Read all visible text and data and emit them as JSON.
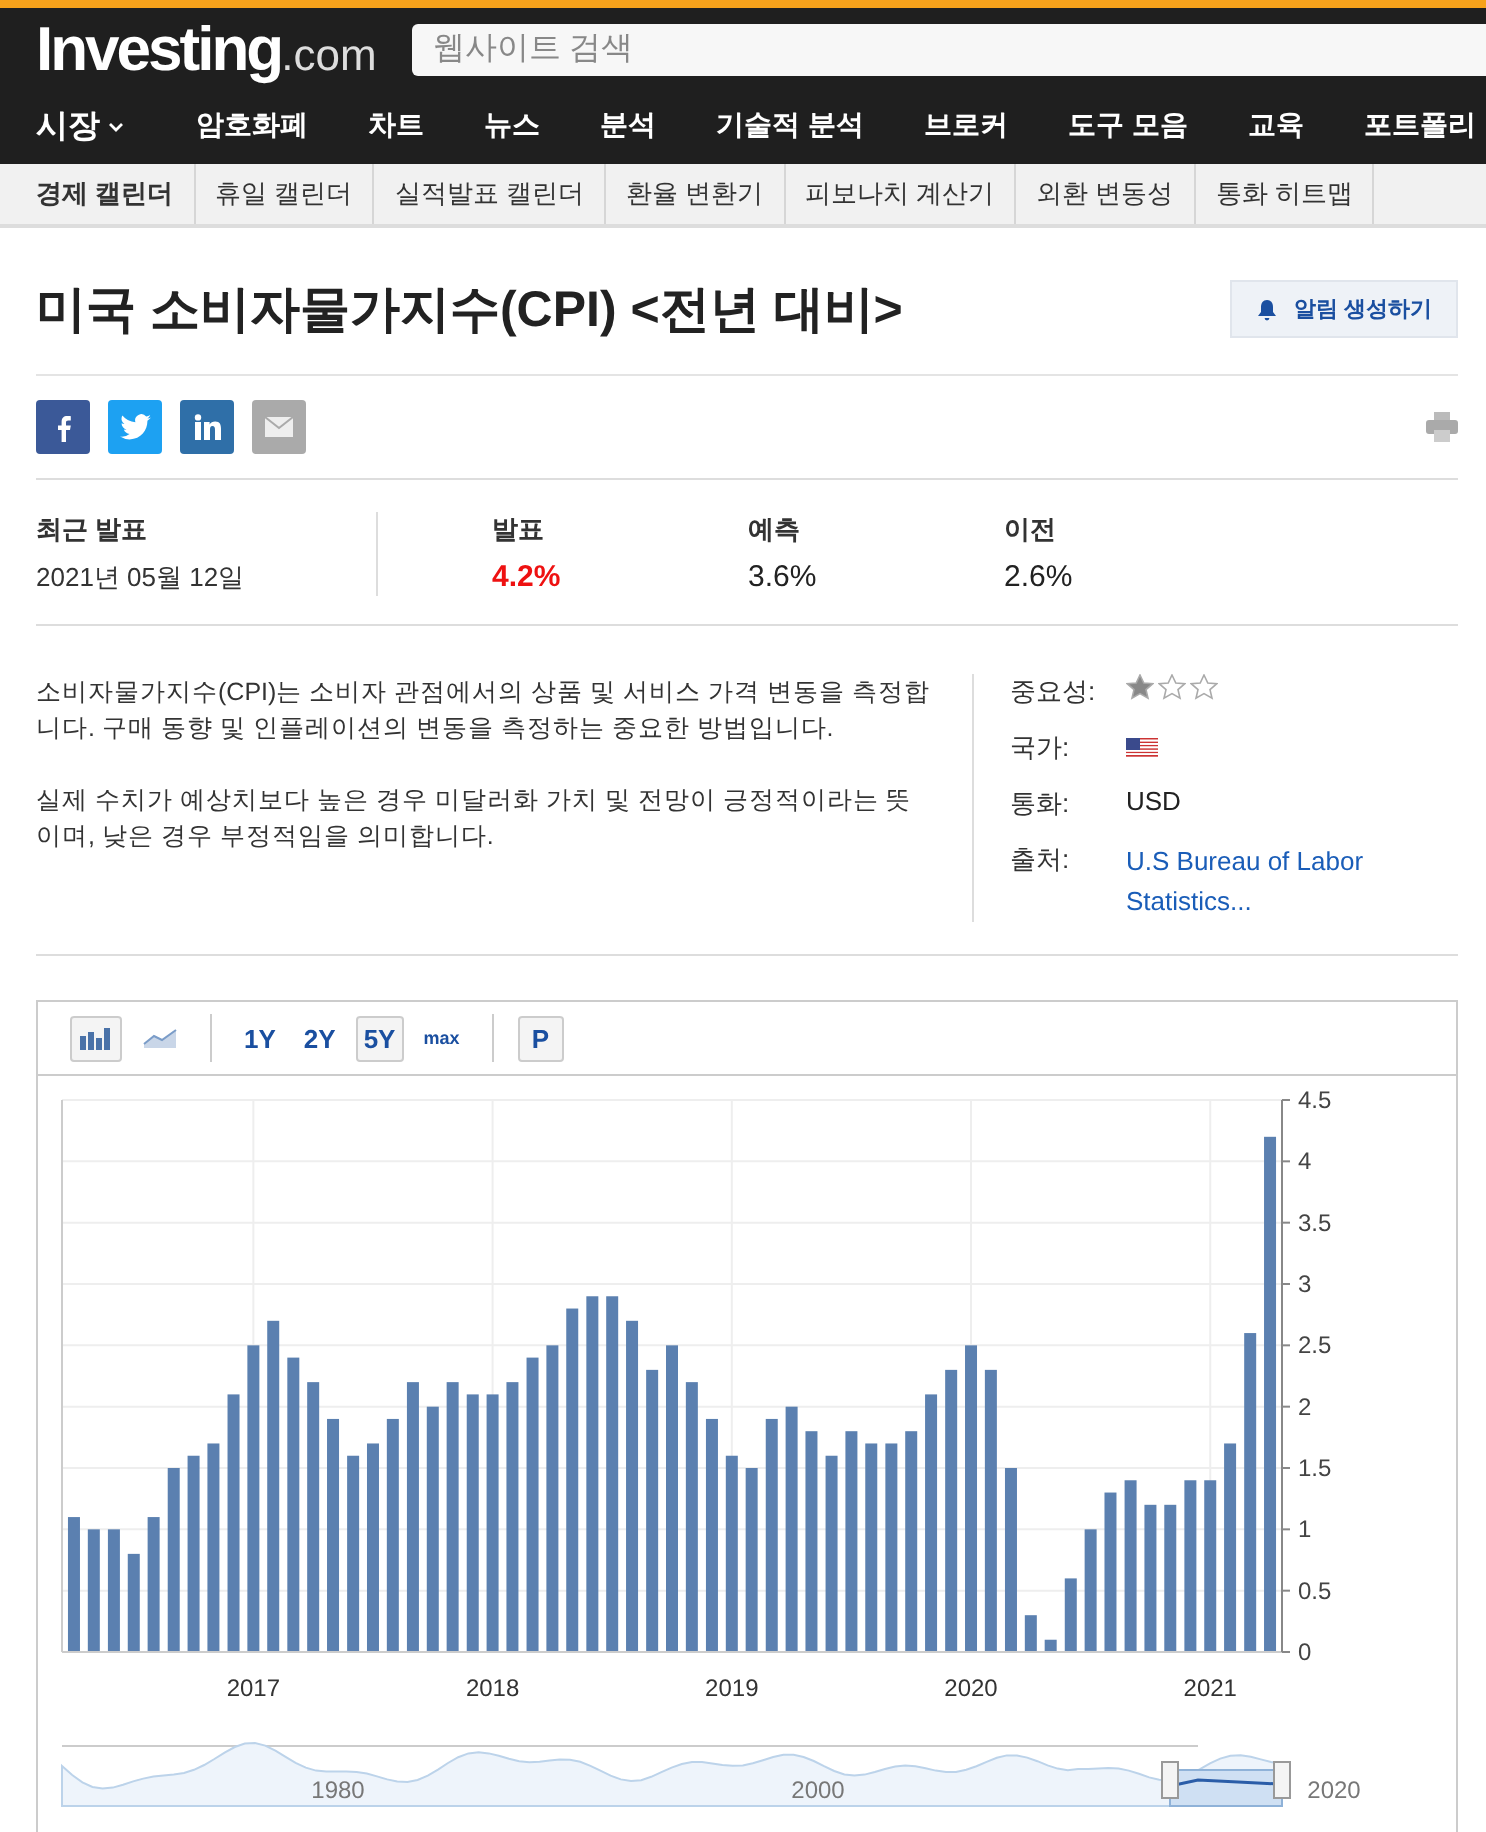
{
  "header": {
    "logo": {
      "main": "Investing",
      "suffix": ".com"
    },
    "search": {
      "placeholder": "웹사이트 검색"
    }
  },
  "nav": [
    {
      "label": "시장",
      "dropdown": true
    },
    {
      "label": "암호화폐",
      "dropdown": false
    },
    {
      "label": "차트",
      "dropdown": false
    },
    {
      "label": "뉴스",
      "dropdown": false
    },
    {
      "label": "분석",
      "dropdown": false
    },
    {
      "label": "기술적 분석",
      "dropdown": false
    },
    {
      "label": "브로커",
      "dropdown": false
    },
    {
      "label": "도구 모음",
      "dropdown": false
    },
    {
      "label": "교육",
      "dropdown": false
    },
    {
      "label": "포트폴리",
      "dropdown": false
    }
  ],
  "subnav": [
    {
      "label": "경제 캘린더",
      "selected": true
    },
    {
      "label": "휴일 캘린더",
      "selected": false
    },
    {
      "label": "실적발표 캘린더",
      "selected": false
    },
    {
      "label": "환율 변환기",
      "selected": false
    },
    {
      "label": "피보나치 계산기",
      "selected": false
    },
    {
      "label": "외환 변동성",
      "selected": false
    },
    {
      "label": "통화 히트맵",
      "selected": false
    }
  ],
  "title": "미국 소비자물가지수(CPI) <전년 대비>",
  "alert_button": "알림 생성하기",
  "release": {
    "label": "최근 발표",
    "date": "2021년 05월 12일",
    "values": [
      {
        "label": "발표",
        "value": "4.2%",
        "kind": "actual"
      },
      {
        "label": "예측",
        "value": "3.6%",
        "kind": "normal"
      },
      {
        "label": "이전",
        "value": "2.6%",
        "kind": "normal"
      }
    ]
  },
  "description": [
    "소비자물가지수(CPI)는 소비자 관점에서의 상품 및 서비스 가격 변동을 측정합니다. 구매 동향 및 인플레이션의 변동을 측정하는 중요한 방법입니다.",
    "실제 수치가 예상치보다 높은 경우 미달러화 가치 및 전망이 긍정적이라는 뜻이며, 낮은 경우 부정적임을 의미합니다."
  ],
  "info": [
    {
      "label": "중요성:",
      "kind": "stars",
      "stars": 1
    },
    {
      "label": "국가:",
      "kind": "flag"
    },
    {
      "label": "통화:",
      "kind": "text",
      "value": "USD"
    },
    {
      "label": "출처:",
      "kind": "link",
      "value": "U.S Bureau of Labor Statistics..."
    }
  ],
  "chart": {
    "types": [
      {
        "kind": "bar",
        "selected": true
      },
      {
        "kind": "line",
        "selected": false
      }
    ],
    "ranges": [
      {
        "label": "1Y",
        "selected": false
      },
      {
        "label": "2Y",
        "selected": false
      },
      {
        "label": "5Y",
        "selected": true
      },
      {
        "label": "max",
        "selected": false
      }
    ],
    "extra_button": "P",
    "chart_data": {
      "type": "bar",
      "grid": true,
      "x": [
        2016.25,
        2016.333,
        2016.417,
        2016.5,
        2016.583,
        2016.667,
        2016.75,
        2016.833,
        2016.917,
        2017,
        2017.083,
        2017.167,
        2017.25,
        2017.333,
        2017.417,
        2017.5,
        2017.583,
        2017.667,
        2017.75,
        2017.833,
        2017.917,
        2018,
        2018.083,
        2018.167,
        2018.25,
        2018.333,
        2018.417,
        2018.5,
        2018.583,
        2018.667,
        2018.75,
        2018.833,
        2018.917,
        2019,
        2019.083,
        2019.167,
        2019.25,
        2019.333,
        2019.417,
        2019.5,
        2019.583,
        2019.667,
        2019.75,
        2019.833,
        2019.917,
        2020,
        2020.083,
        2020.167,
        2020.25,
        2020.333,
        2020.417,
        2020.5,
        2020.583,
        2020.667,
        2020.75,
        2020.833,
        2020.917,
        2021,
        2021.083,
        2021.167,
        2021.25
      ],
      "series": [
        {
          "color": "#5b80b0",
          "values": [
            1.1,
            1.0,
            1.0,
            0.8,
            1.1,
            1.5,
            1.6,
            1.7,
            2.1,
            2.5,
            2.7,
            2.4,
            2.2,
            1.9,
            1.6,
            1.7,
            1.9,
            2.2,
            2.0,
            2.2,
            2.1,
            2.1,
            2.2,
            2.4,
            2.5,
            2.8,
            2.9,
            2.9,
            2.7,
            2.3,
            2.5,
            2.2,
            1.9,
            1.6,
            1.5,
            1.9,
            2.0,
            1.8,
            1.6,
            1.8,
            1.7,
            1.7,
            1.8,
            2.1,
            2.3,
            2.5,
            2.3,
            1.5,
            0.3,
            0.1,
            0.6,
            1.0,
            1.3,
            1.4,
            1.2,
            1.2,
            1.4,
            1.4,
            1.7,
            2.6,
            4.2
          ]
        }
      ],
      "xlim": [
        2016.2,
        2021.3
      ],
      "ylim": [
        0,
        4.5
      ],
      "yticks": [
        0,
        0.5,
        1,
        1.5,
        2,
        2.5,
        3,
        3.5,
        4,
        4.5
      ],
      "xticks": [
        2017,
        2018,
        2019,
        2020,
        2021
      ]
    },
    "navigator_labels": [
      "1980",
      "2000",
      "2020"
    ]
  }
}
